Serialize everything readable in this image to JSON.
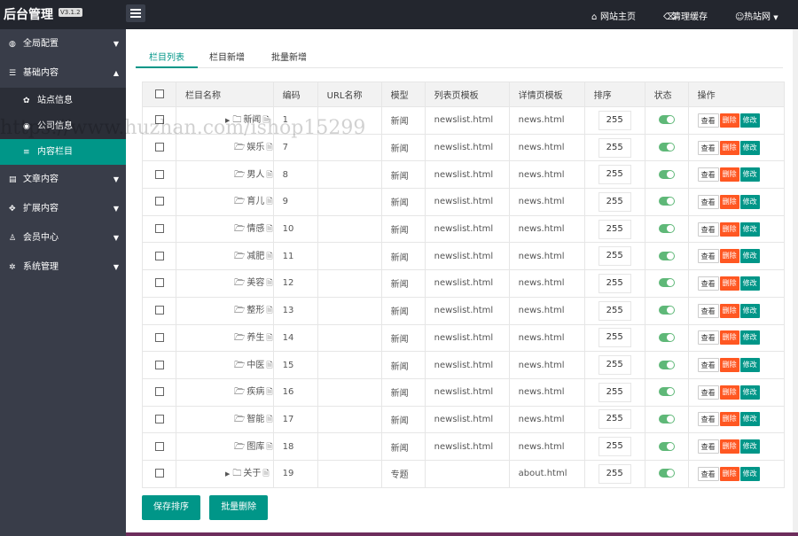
{
  "app": {
    "title": "后台管理",
    "version": "V3.1.2"
  },
  "topnav": [
    {
      "label": "网站主页",
      "icon": "home-icon"
    },
    {
      "label": "清理缓存",
      "icon": "trash-icon"
    },
    {
      "label": "热站网",
      "icon": "user-icon"
    }
  ],
  "sidebar": {
    "items": [
      {
        "label": "全局配置",
        "icon": "globe-icon"
      },
      {
        "label": "基础内容",
        "icon": "sliders-icon"
      },
      {
        "label": "文章内容",
        "icon": "document-icon"
      },
      {
        "label": "扩展内容",
        "icon": "expand-icon"
      },
      {
        "label": "会员中心",
        "icon": "user-icon"
      },
      {
        "label": "系统管理",
        "icon": "gear-icon"
      }
    ],
    "subitems": [
      {
        "label": "站点信息",
        "icon": "gear-icon"
      },
      {
        "label": "公司信息",
        "icon": "building-icon"
      },
      {
        "label": "内容栏目",
        "icon": "list-icon"
      }
    ]
  },
  "tabs": [
    "栏目列表",
    "栏目新增",
    "批量新增"
  ],
  "table": {
    "headers": [
      "栏目名称",
      "编码",
      "URL名称",
      "模型",
      "列表页模板",
      "详情页模板",
      "排序",
      "状态",
      "操作"
    ],
    "rows": [
      {
        "name": "新闻",
        "code": "1",
        "url": "",
        "model": "新闻",
        "list_tpl": "newslist.html",
        "detail_tpl": "news.html",
        "sort": "255"
      },
      {
        "name": "娱乐",
        "code": "7",
        "url": "",
        "model": "新闻",
        "list_tpl": "newslist.html",
        "detail_tpl": "news.html",
        "sort": "255"
      },
      {
        "name": "男人",
        "code": "8",
        "url": "",
        "model": "新闻",
        "list_tpl": "newslist.html",
        "detail_tpl": "news.html",
        "sort": "255"
      },
      {
        "name": "育儿",
        "code": "9",
        "url": "",
        "model": "新闻",
        "list_tpl": "newslist.html",
        "detail_tpl": "news.html",
        "sort": "255"
      },
      {
        "name": "情感",
        "code": "10",
        "url": "",
        "model": "新闻",
        "list_tpl": "newslist.html",
        "detail_tpl": "news.html",
        "sort": "255"
      },
      {
        "name": "减肥",
        "code": "11",
        "url": "",
        "model": "新闻",
        "list_tpl": "newslist.html",
        "detail_tpl": "news.html",
        "sort": "255"
      },
      {
        "name": "美容",
        "code": "12",
        "url": "",
        "model": "新闻",
        "list_tpl": "newslist.html",
        "detail_tpl": "news.html",
        "sort": "255"
      },
      {
        "name": "整形",
        "code": "13",
        "url": "",
        "model": "新闻",
        "list_tpl": "newslist.html",
        "detail_tpl": "news.html",
        "sort": "255"
      },
      {
        "name": "养生",
        "code": "14",
        "url": "",
        "model": "新闻",
        "list_tpl": "newslist.html",
        "detail_tpl": "news.html",
        "sort": "255"
      },
      {
        "name": "中医",
        "code": "15",
        "url": "",
        "model": "新闻",
        "list_tpl": "newslist.html",
        "detail_tpl": "news.html",
        "sort": "255"
      },
      {
        "name": "疾病",
        "code": "16",
        "url": "",
        "model": "新闻",
        "list_tpl": "newslist.html",
        "detail_tpl": "news.html",
        "sort": "255"
      },
      {
        "name": "智能",
        "code": "17",
        "url": "",
        "model": "新闻",
        "list_tpl": "newslist.html",
        "detail_tpl": "news.html",
        "sort": "255"
      },
      {
        "name": "图库",
        "code": "18",
        "url": "",
        "model": "新闻",
        "list_tpl": "newslist.html",
        "detail_tpl": "news.html",
        "sort": "255"
      },
      {
        "name": "关于",
        "code": "19",
        "url": "",
        "model": "专题",
        "list_tpl": "",
        "detail_tpl": "about.html",
        "sort": "255"
      }
    ],
    "actions": {
      "view": "查看",
      "delete": "删除",
      "edit": "修改"
    }
  },
  "buttons": {
    "save_sort": "保存排序",
    "batch_delete": "批量删除"
  },
  "watermark": "https://www.huzhan.com/ishop15299",
  "colors": {
    "accent": "#009688",
    "danger": "#ff5722",
    "sidebar": "#393d49",
    "topbar": "#23262e"
  }
}
